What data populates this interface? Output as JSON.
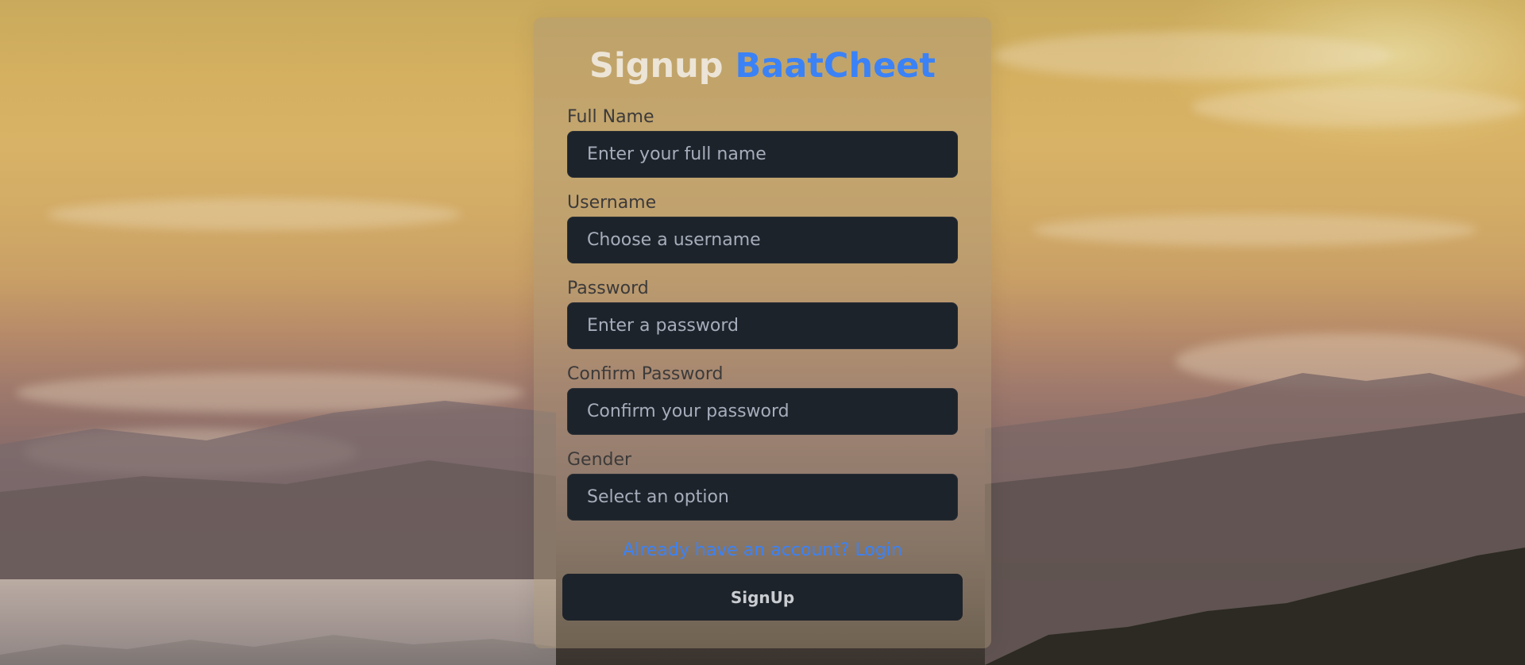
{
  "header": {
    "title_word1": "Signup",
    "title_word2": "BaatCheet"
  },
  "form": {
    "full_name": {
      "label": "Full Name",
      "placeholder": "Enter your full name"
    },
    "username": {
      "label": "Username",
      "placeholder": "Choose a username"
    },
    "password": {
      "label": "Password",
      "placeholder": "Enter a password"
    },
    "confirm_password": {
      "label": "Confirm Password",
      "placeholder": "Confirm your password"
    },
    "gender": {
      "label": "Gender",
      "selected": "Select an option"
    },
    "login_link": "Already have an account? Login",
    "submit_label": "SignUp"
  },
  "colors": {
    "accent": "#3b82f6",
    "input_bg": "#1d232a",
    "placeholder": "#a6adbb"
  }
}
